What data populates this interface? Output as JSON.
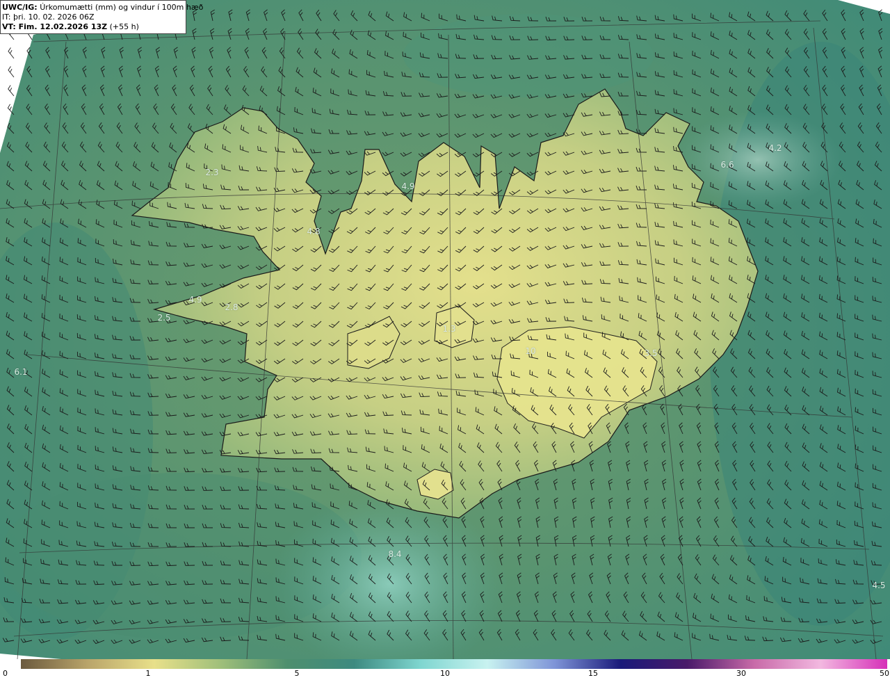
{
  "header": {
    "title_bold": "UWC/IG:",
    "title_rest": "Úrkomumætti (mm) og vindur í 100m hæð",
    "it_line": "IT: þri. 10. 02. 2026 06Z",
    "vt_bold": "VT: Fim. 12.02.2026 13Z",
    "vt_rest": "(+55 h)"
  },
  "colorbar": {
    "ticks": [
      "0",
      "1",
      "5",
      "10",
      "15",
      "30",
      "50"
    ],
    "colors": [
      "#6b5a3e",
      "#b9a46a",
      "#e8e08a",
      "#9fbf7a",
      "#4e8f6e",
      "#3d8a80",
      "#7fd6d0",
      "#c8f2f0",
      "#7f95d8",
      "#1a1a7a",
      "#4a1a6a",
      "#c86aa8",
      "#f2b8e0",
      "#d62fb8"
    ]
  },
  "labels": [
    {
      "text": "2.3"
    },
    {
      "text": "4.9"
    },
    {
      "text": "4.8"
    },
    {
      "text": "4.9"
    },
    {
      "text": "2.8"
    },
    {
      "text": "2.5"
    },
    {
      "text": "6.1"
    },
    {
      "text": "6.6"
    },
    {
      "text": "4.2"
    },
    {
      "text": "10"
    },
    {
      "text": "3.5"
    },
    {
      "text": "1.3"
    },
    {
      "text": "8.4"
    },
    {
      "text": "4.5"
    }
  ],
  "map": {
    "ocean_color": "#3c8a74",
    "land_low_color": "#8cb878",
    "land_high_color": "#e2e08e",
    "coast_color": "#1a1a1a"
  }
}
